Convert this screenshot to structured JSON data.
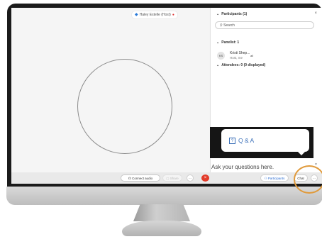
{
  "stage": {
    "presenter_name": "Haley Estelle (Host)",
    "presenter_icon": "screen-share-icon",
    "mic_icon": "mic-muted-icon"
  },
  "participants_panel": {
    "title": "Participants (1)",
    "close": "×",
    "search_placeholder": "Search",
    "panelist_heading": "Panelist: 1",
    "panelist": {
      "initials": "KS",
      "name": "Kristi Shep...",
      "role": "Host, me",
      "badge": "all"
    },
    "attendees_heading": "Attendees: 0 (0 displayed)"
  },
  "chat": {
    "qa_label": "Q & A",
    "qa_icon": "?",
    "close": "×",
    "input_placeholder": "Ask your questions here."
  },
  "toolbar": {
    "connect_audio": "Connect audio",
    "share": "Share",
    "more": "···",
    "leave": "×",
    "participants": "Participants",
    "chat": "Chat",
    "ellipsis": "···"
  },
  "colors": {
    "accent": "#3a6fb8",
    "leave": "#e23b2a",
    "highlight_ring": "#e09a3b"
  }
}
